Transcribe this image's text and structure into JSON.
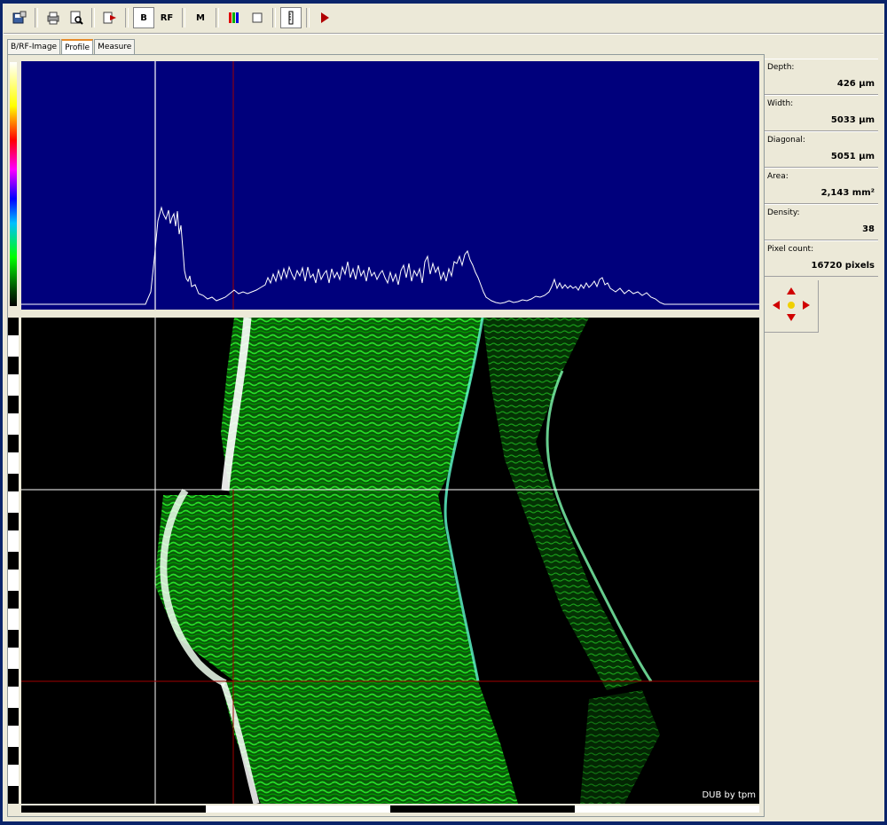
{
  "toolbar": {
    "buttons": [
      {
        "name": "save-icon"
      },
      {
        "name": "print-icon"
      },
      {
        "name": "print-preview-icon"
      },
      {
        "name": "export-icon"
      },
      {
        "name": "b-mode-button",
        "label": "B"
      },
      {
        "name": "rf-mode-button",
        "label": "RF"
      },
      {
        "name": "m-mode-button",
        "label": "M"
      },
      {
        "name": "color-palette-icon"
      },
      {
        "name": "roi-checkbox-icon"
      },
      {
        "name": "ruler-icon"
      },
      {
        "name": "play-icon"
      }
    ],
    "b_label": "B",
    "rf_label": "RF",
    "m_label": "M"
  },
  "tabs": [
    {
      "label": "B/RF-Image"
    },
    {
      "label": "Profile",
      "active": true
    },
    {
      "label": "Measure"
    }
  ],
  "measurements": [
    {
      "label": "Depth:",
      "value": "426 µm"
    },
    {
      "label": "Width:",
      "value": "5033 µm"
    },
    {
      "label": "Diagonal:",
      "value": "5051 µm"
    },
    {
      "label": "Area:",
      "value": "2,143 mm²"
    },
    {
      "label": "Density:",
      "value": "38"
    },
    {
      "label": "Pixel count:",
      "value": "16720 pixels"
    }
  ],
  "image": {
    "credit": "DUB by tpm"
  },
  "colors": {
    "profile_background": "#00007c",
    "profile_line": "#ffffff",
    "cursor_white": "#ffffff",
    "cursor_red": "#a00000",
    "tissue_green": "#00ff00",
    "arrows": "#d00000"
  }
}
